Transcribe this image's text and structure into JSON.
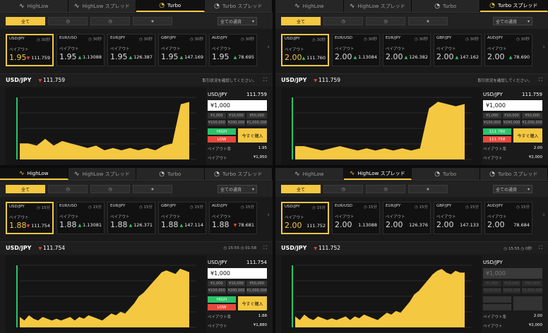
{
  "colors": {
    "accent": "#f5c842",
    "up": "#2bc46a",
    "down": "#e8483c",
    "bg": "#1a1a1a"
  },
  "panels": [
    {
      "tabs": [
        {
          "label": "HighLow",
          "icon": "chart-icon"
        },
        {
          "label": "HighLow スプレッド",
          "icon": "chart-icon"
        },
        {
          "label": "Turbo",
          "icon": "turbo-icon",
          "active": true
        },
        {
          "label": "Turbo スプレッド",
          "icon": "turbo-icon"
        }
      ],
      "filters": [
        {
          "label": "全て",
          "active": true
        },
        {
          "label": "",
          "icon": "clock-icon"
        },
        {
          "label": "",
          "icon": "clock-icon"
        },
        {
          "label": "",
          "icon": "star-icon"
        }
      ],
      "select": "全ての通貨",
      "cards": [
        {
          "pair": "USD/JPY",
          "time": "30秒",
          "payout": "1.95",
          "rate": "111.759",
          "dir": "down",
          "selected": true
        },
        {
          "pair": "EUR/USD",
          "time": "30秒",
          "payout": "1.95",
          "rate": "1.13088",
          "dir": "up"
        },
        {
          "pair": "EUR/JPY",
          "time": "30秒",
          "payout": "1.95",
          "rate": "126.387",
          "dir": "up"
        },
        {
          "pair": "GBP/JPY",
          "time": "30秒",
          "payout": "1.95",
          "rate": "147.169",
          "dir": "up"
        },
        {
          "pair": "AUD/JPY",
          "time": "30秒",
          "payout": "1.95",
          "rate": "78.695",
          "dir": "up"
        }
      ],
      "payout_label": "ペイアウト",
      "pair": "USD/JPY",
      "price": "111.759",
      "info": "取引状況を確認してください。",
      "trade": {
        "pair": "USD/JPY",
        "price": "111.759",
        "amount": "¥1,000",
        "amounts": [
          "¥1,000",
          "¥10,000",
          "¥50,000",
          "¥100,000",
          "¥200,000",
          "¥1,000,000"
        ],
        "high": "HIGH",
        "low": "LOW",
        "buy": "今すぐ購入",
        "payout_label": "ペイアウト率",
        "payout": "1.95",
        "return_label": "ペイアウト",
        "return": "¥1,950"
      },
      "chart_data": {
        "type": "area",
        "y": [
          111.742,
          111.742,
          111.741,
          111.744,
          111.741,
          111.743,
          111.742,
          111.741,
          111.74,
          111.741,
          111.739,
          111.74,
          111.739,
          111.74,
          111.739,
          111.74,
          111.739,
          111.741,
          111.742,
          111.759,
          111.76
        ]
      }
    },
    {
      "tabs": [
        {
          "label": "HighLow",
          "icon": "chart-icon"
        },
        {
          "label": "HighLow スプレッド",
          "icon": "chart-icon"
        },
        {
          "label": "Turbo",
          "icon": "turbo-icon"
        },
        {
          "label": "Turbo スプレッド",
          "icon": "turbo-icon",
          "active": true
        }
      ],
      "filters": [
        {
          "label": "全て",
          "active": true
        },
        {
          "label": "",
          "icon": "clock-icon"
        },
        {
          "label": "",
          "icon": "clock-icon"
        },
        {
          "label": "",
          "icon": "star-icon"
        }
      ],
      "select": "全ての通貨",
      "cards": [
        {
          "pair": "USD/JPY",
          "time": "30秒",
          "payout": "2.00",
          "rate": "111.760",
          "dir": "up",
          "selected": true
        },
        {
          "pair": "EUR/USD",
          "time": "30秒",
          "payout": "2.00",
          "rate": "1.13084",
          "dir": "up"
        },
        {
          "pair": "EUR/JPY",
          "time": "30秒",
          "payout": "2.00",
          "rate": "126.382",
          "dir": "up"
        },
        {
          "pair": "GBP/JPY",
          "time": "30秒",
          "payout": "2.00",
          "rate": "147.162",
          "dir": "up"
        },
        {
          "pair": "AUD/JPY",
          "time": "30秒",
          "payout": "2.00",
          "rate": "78.690",
          "dir": "up"
        }
      ],
      "payout_label": "ペイアウト",
      "pair": "USD/JPY",
      "price": "111.759",
      "info": "取引状況を確認してください。",
      "trade": {
        "pair": "USD/JPY",
        "price": "111.759",
        "amount": "¥1,000",
        "amounts": [
          "¥1,000",
          "¥10,000",
          "¥50,000",
          "¥100,000",
          "¥200,000",
          "¥1,000,000"
        ],
        "high": "111.760",
        "low": "111.758",
        "buy": "今すぐ購入",
        "payout_label": "ペイアウト率",
        "payout": "2.00",
        "return_label": "ペイアウト",
        "return": "¥2,000"
      },
      "chart_data": {
        "type": "area",
        "y": [
          111.742,
          111.742,
          111.741,
          111.74,
          111.741,
          111.742,
          111.741,
          111.74,
          111.741,
          111.74,
          111.741,
          111.74,
          111.741,
          111.74,
          111.741,
          111.759,
          111.762,
          111.761,
          111.76,
          111.761
        ]
      }
    },
    {
      "tabs": [
        {
          "label": "HighLow",
          "icon": "chart-icon",
          "active": true
        },
        {
          "label": "HighLow スプレッド",
          "icon": "chart-icon"
        },
        {
          "label": "Turbo",
          "icon": "turbo-icon"
        },
        {
          "label": "Turbo スプレッド",
          "icon": "turbo-icon"
        }
      ],
      "filters": [
        {
          "label": "全て",
          "active": true
        },
        {
          "label": "",
          "icon": "clock-icon"
        },
        {
          "label": "",
          "icon": "clock-icon"
        },
        {
          "label": "",
          "icon": "star-icon"
        }
      ],
      "select": "全ての通貨",
      "cards": [
        {
          "pair": "USD/JPY",
          "time": "15分",
          "payout": "1.88",
          "rate": "111.754",
          "dir": "down",
          "selected": true
        },
        {
          "pair": "EUR/USD",
          "time": "15分",
          "payout": "1.88",
          "rate": "1.13081",
          "dir": "up"
        },
        {
          "pair": "EUR/JPY",
          "time": "15分",
          "payout": "1.88",
          "rate": "126.371",
          "dir": "up"
        },
        {
          "pair": "GBP/JPY",
          "time": "15分",
          "payout": "1.88",
          "rate": "147.114",
          "dir": "up"
        },
        {
          "pair": "AUD/JPY",
          "time": "15分",
          "payout": "1.88",
          "rate": "78.681",
          "dir": "down"
        }
      ],
      "payout_label": "ペイアウト",
      "pair": "USD/JPY",
      "price": "111.754",
      "info": "◷ 15:55   ◷ 01:58",
      "trade": {
        "pair": "USD/JPY",
        "price": "111.754",
        "amount": "¥1,000",
        "amounts": [
          "¥1,000",
          "¥10,000",
          "¥50,000",
          "¥100,000",
          "¥200,000",
          "¥1,000,000"
        ],
        "high": "HIGH",
        "low": "LOW",
        "buy": "今すぐ購入",
        "payout_label": "ペイアウト率",
        "payout": "1.88",
        "return_label": "ペイアウト",
        "return": "¥1,880"
      },
      "chart_data": {
        "type": "area",
        "y": [
          111.728,
          111.726,
          111.729,
          111.727,
          111.726,
          111.728,
          111.727,
          111.726,
          111.727,
          111.726,
          111.727,
          111.728,
          111.726,
          111.728,
          111.727,
          111.729,
          111.728,
          111.727,
          111.726,
          111.728,
          111.73,
          111.729,
          111.731,
          111.73,
          111.733,
          111.736,
          111.74,
          111.742,
          111.745,
          111.748,
          111.751,
          111.754,
          111.755,
          111.754,
          111.753,
          111.756,
          111.755,
          111.754
        ]
      }
    },
    {
      "tabs": [
        {
          "label": "HighLow",
          "icon": "chart-icon"
        },
        {
          "label": "HighLow スプレッド",
          "icon": "chart-icon",
          "active": true
        },
        {
          "label": "Turbo",
          "icon": "turbo-icon"
        },
        {
          "label": "Turbo スプレッド",
          "icon": "turbo-icon"
        }
      ],
      "filters": [
        {
          "label": "全て",
          "active": true
        },
        {
          "label": "",
          "icon": "clock-icon"
        },
        {
          "label": "",
          "icon": "clock-icon"
        },
        {
          "label": "",
          "icon": "star-icon"
        }
      ],
      "select": "全ての通貨",
      "cards": [
        {
          "pair": "USD/JPY",
          "time": "15分",
          "payout": "2.00",
          "rate": "111.752",
          "dir": "none",
          "selected": true
        },
        {
          "pair": "EUR/USD",
          "time": "15分",
          "payout": "2.00",
          "rate": "1.13088",
          "dir": "none"
        },
        {
          "pair": "EUR/JPY",
          "time": "15分",
          "payout": "2.00",
          "rate": "126.376",
          "dir": "none"
        },
        {
          "pair": "GBP/JPY",
          "time": "15分",
          "payout": "2.00",
          "rate": "147.133",
          "dir": "none"
        },
        {
          "pair": "AUD/JPY",
          "time": "15分",
          "payout": "2.00",
          "rate": "78.684",
          "dir": "none"
        }
      ],
      "payout_label": "ペイアウト",
      "pair": "USD/JPY",
      "price": "111.752",
      "info": "◷ 15:55   ◷ 0秒",
      "trade": {
        "pair": "USD/JPY",
        "price": "",
        "amount": "¥1,000",
        "amounts": [
          "¥1,000",
          "¥10,000",
          "¥50,000",
          "¥100,000",
          "¥200,000",
          "¥1,000,000"
        ],
        "high": "",
        "low": "",
        "buy": "",
        "payout_label": "ペイアウト率",
        "payout": "2.00",
        "return_label": "ペイアウト",
        "return": "¥2,000",
        "disabled": true
      },
      "chart_data": {
        "type": "area",
        "y": [
          111.728,
          111.726,
          111.729,
          111.727,
          111.726,
          111.728,
          111.727,
          111.726,
          111.727,
          111.726,
          111.727,
          111.728,
          111.726,
          111.728,
          111.727,
          111.729,
          111.728,
          111.727,
          111.726,
          111.728,
          111.73,
          111.729,
          111.731,
          111.73,
          111.733,
          111.736,
          111.74,
          111.742,
          111.745,
          111.748,
          111.751,
          111.753,
          111.754,
          111.752,
          111.751,
          111.753,
          111.752,
          111.752
        ]
      }
    }
  ]
}
